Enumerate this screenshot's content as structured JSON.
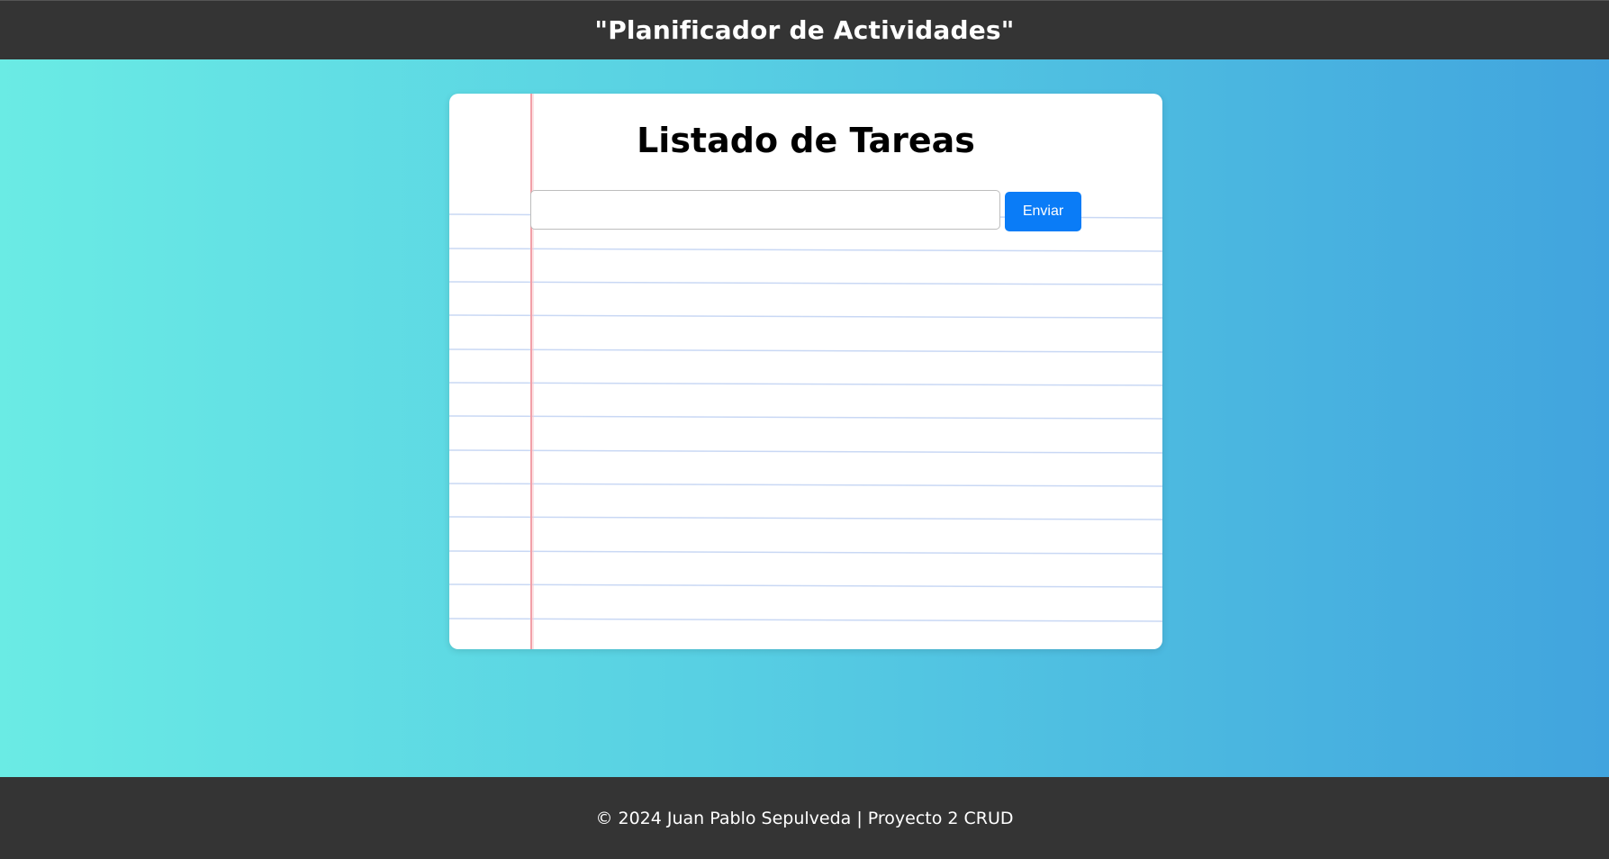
{
  "header": {
    "title": "\"Planificador de Actividades\""
  },
  "card": {
    "title": "Listado de Tareas",
    "input": {
      "value": "",
      "placeholder": ""
    },
    "submit_label": "Enviar"
  },
  "footer": {
    "text": "© 2024 Juan Pablo Sepulveda | Proyecto 2 CRUD"
  },
  "colors": {
    "header_bg": "#343434",
    "footer_bg": "#343434",
    "gradient_start": "#6aebe4",
    "gradient_end": "#41a4de",
    "button_bg": "#0a7cf7",
    "paper_line": "#c9d8f4",
    "margin_line": "#f2a0a8"
  }
}
